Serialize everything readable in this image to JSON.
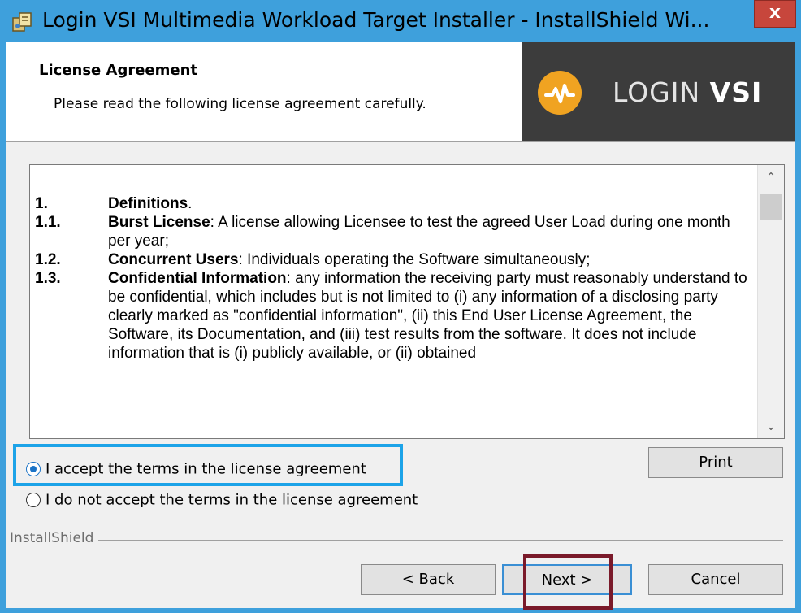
{
  "window": {
    "title": "Login VSI Multimedia Workload Target Installer - InstallShield Wi...",
    "close_label": "x"
  },
  "header": {
    "title": "License Agreement",
    "subtitle": "Please read the following license agreement carefully.",
    "logo_text_light": "LOGIN ",
    "logo_text_bold": "VSI"
  },
  "license": {
    "items": [
      {
        "num": "1.",
        "term": "Definitions",
        "text": "."
      },
      {
        "num": "1.1.",
        "term": "Burst License",
        "text": ": A license allowing Licensee to test the agreed User Load during one month per year;"
      },
      {
        "num": "1.2.",
        "term": "Concurrent Users",
        "text": ": Individuals operating the Software simultaneously;"
      },
      {
        "num": "1.3.",
        "term": "Confidential Information",
        "text": ": any information the receiving party must reasonably understand to be confidential, which includes but is not limited to (i) any information of a disclosing party clearly marked as \"confidential information\", (ii) this End User License Agreement, the Software,  its Documentation, and  (iii) test results from the software. It does not include information that is (i) publicly available, or (ii) obtained"
      }
    ]
  },
  "options": {
    "accept_label": "I accept the terms in the license agreement",
    "decline_label": "I do not accept the terms in the license agreement",
    "selected": "accept"
  },
  "buttons": {
    "print": "Print",
    "back": "< Back",
    "next": "Next >",
    "cancel": "Cancel"
  },
  "footer": {
    "brand": "InstallShield"
  },
  "colors": {
    "title_bar": "#3ea0dc",
    "close_button": "#c7463c",
    "logo_bg": "#3c3c3c",
    "logo_accent": "#f0a321",
    "accept_highlight": "#1ca3e8",
    "next_highlight": "#7a1a2a"
  }
}
